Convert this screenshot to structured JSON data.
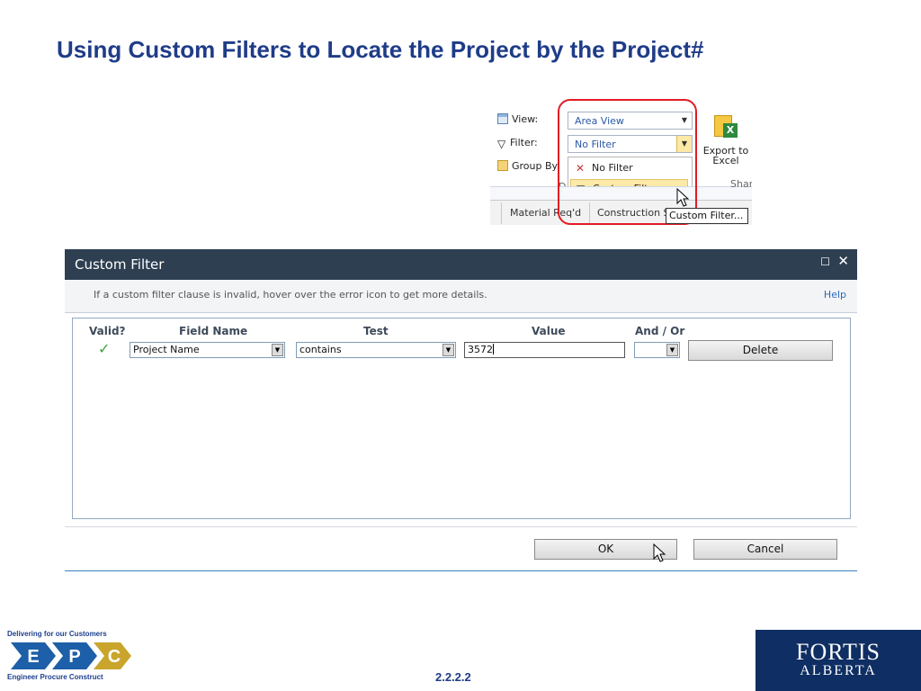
{
  "slide": {
    "title": "Using Custom Filters to Locate the Project by the Project#",
    "page_number": "2.2.2.2"
  },
  "ribbon": {
    "view_label": "View:",
    "view_value": "Area View",
    "filter_label": "Filter:",
    "filter_value": "No Filter",
    "group_label": "Group By:",
    "menu": [
      "No Filter",
      "Custom Filter..."
    ],
    "export_line1": "Export to",
    "export_line2": "Excel",
    "group_fragment_d": "D",
    "group_fragment_share": "Shar",
    "col_headers": [
      "Material Req'd",
      "Construction S"
    ],
    "tooltip": "Custom Filter..."
  },
  "dialog": {
    "title": "Custom Filter",
    "hint": "If a custom filter clause is invalid, hover over the error icon to get more details.",
    "help": "Help",
    "headers": {
      "valid": "Valid?",
      "field_name": "Field Name",
      "test": "Test",
      "value": "Value",
      "and_or": "And / Or"
    },
    "row": {
      "field_name": "Project Name",
      "test": "contains",
      "value": "3572",
      "and_or": ""
    },
    "delete_label": "Delete",
    "ok_label": "OK",
    "cancel_label": "Cancel"
  },
  "footer": {
    "epc_tagline": "Delivering for our Customers",
    "epc_letters": [
      "E",
      "P",
      "C"
    ],
    "epc_subtitle": "Engineer  Procure  Construct",
    "fortis_line1": "FORTIS",
    "fortis_line2": "ALBERTA"
  },
  "colors": {
    "title": "#1f3c88",
    "dialog_header": "#2e3f52",
    "highlight": "#e21b24",
    "epc_blue": "#1d5fa8",
    "epc_gold": "#c9a52c",
    "fortis_navy": "#0f2e63"
  }
}
